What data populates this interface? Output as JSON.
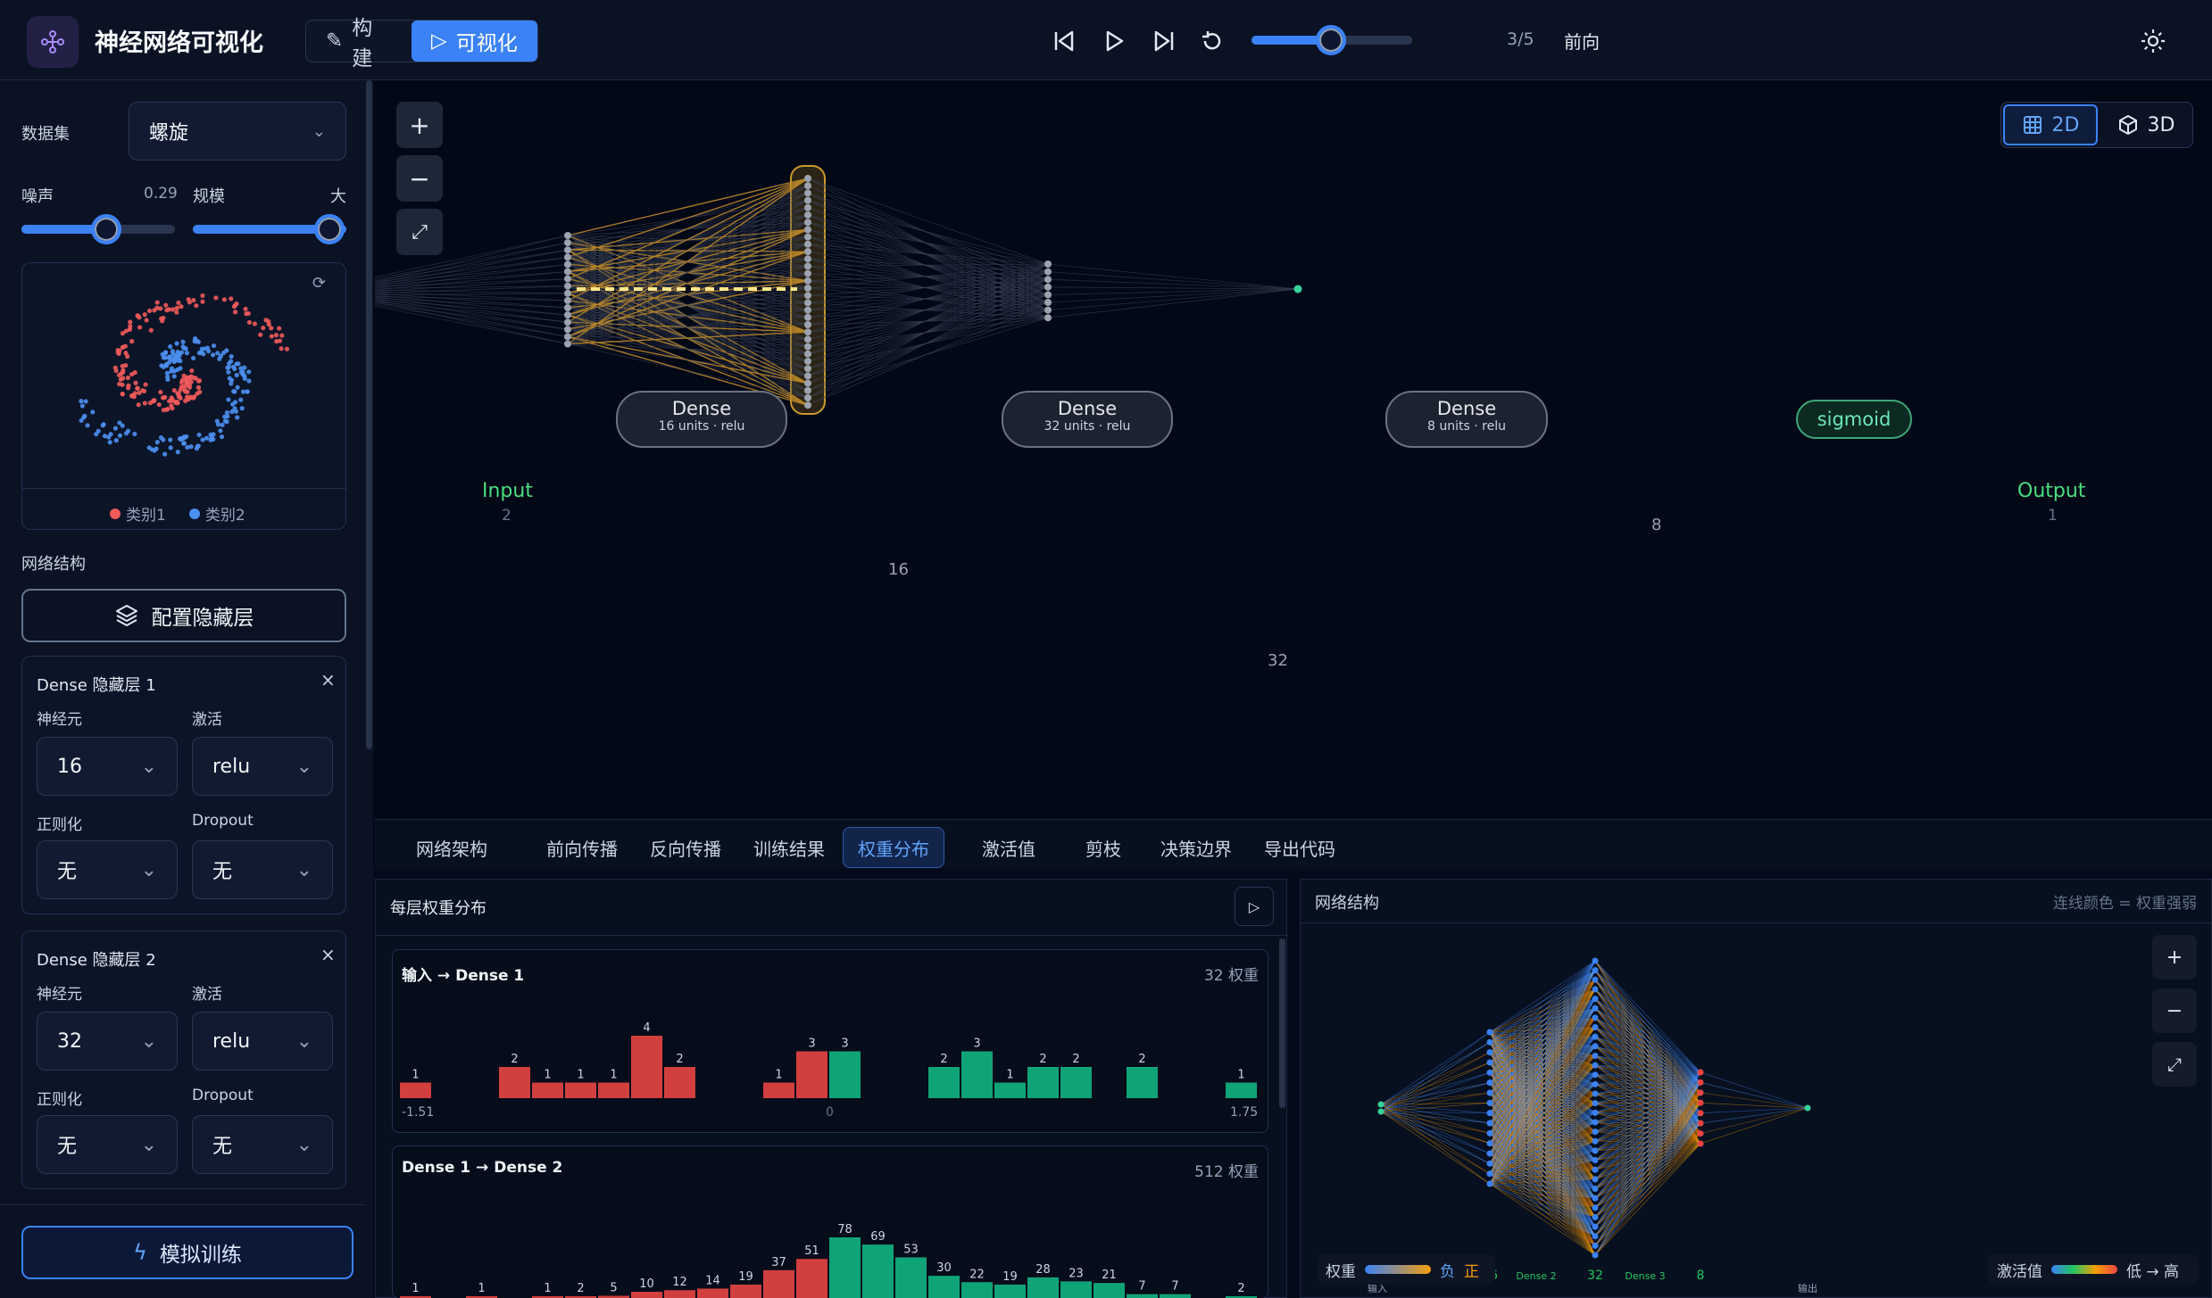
{
  "app": {
    "title": "神经网络可视化"
  },
  "header": {
    "modes": [
      {
        "label": "构建"
      },
      {
        "label": "可视化"
      }
    ],
    "step_text": "3/5",
    "direction": "前向",
    "progress": 0.5
  },
  "sidebar": {
    "dataset_label": "数据集",
    "dataset_value": "螺旋",
    "noise_label": "噪声",
    "noise_value": "0.29",
    "noise_level": 0.29,
    "scale_label": "规模",
    "scale_value": "大",
    "legend": [
      {
        "label": "类别1",
        "color": "#f05a5a"
      },
      {
        "label": "类别2",
        "color": "#4b8ff0"
      }
    ],
    "network_label": "网络结构",
    "config_button": "配置隐藏层",
    "layers": [
      {
        "title": "Dense 隐藏层 1",
        "neurons_label": "神经元",
        "neurons": "16",
        "activation_label": "激活",
        "activation": "relu",
        "reg_label": "正则化",
        "reg": "无",
        "dropout_label": "Dropout",
        "dropout": "无"
      },
      {
        "title": "Dense 隐藏层 2",
        "neurons_label": "神经元",
        "neurons": "32",
        "activation_label": "激活",
        "activation": "relu",
        "reg_label": "正则化",
        "reg": "无",
        "dropout_label": "Dropout",
        "dropout": "无"
      }
    ],
    "train_button": "模拟训练"
  },
  "canvas": {
    "view_2d": "2D",
    "view_3d": "3D",
    "input": {
      "name": "Input",
      "count": "2"
    },
    "output": {
      "name": "Output",
      "count": "1"
    },
    "pills": [
      {
        "title": "Dense",
        "sub": "16 units · relu"
      },
      {
        "title": "Dense",
        "sub": "32 units · relu"
      },
      {
        "title": "Dense",
        "sub": "8 units · relu"
      }
    ],
    "counts": [
      "16",
      "32",
      "8"
    ],
    "sigmoid": "sigmoid"
  },
  "tabs": [
    "网络架构",
    "前向传播",
    "反向传播",
    "训练结果",
    "权重分布",
    "激活值",
    "剪枝",
    "决策边界",
    "导出代码"
  ],
  "active_tab": 4,
  "weights_panel": {
    "title": "每层权重分布",
    "hist1": {
      "title": "输入 → Dense 1",
      "count": "32 权重",
      "min": "-1.51",
      "zero": "0",
      "max": "1.75",
      "bars": [
        1,
        0,
        0,
        2,
        1,
        1,
        1,
        4,
        2,
        0,
        0,
        1,
        3,
        3,
        0,
        0,
        2,
        3,
        1,
        2,
        2,
        0,
        2,
        0,
        0,
        1
      ],
      "labels": [
        "1",
        "",
        "",
        "2",
        "1",
        "1",
        "1",
        "4",
        "2",
        "",
        "",
        "1",
        "3",
        "3",
        "",
        "",
        "2",
        "3",
        "1",
        "2",
        "2",
        "",
        "2",
        "",
        "",
        "1"
      ]
    },
    "hist2": {
      "title": "Dense 1 → Dense 2",
      "count": "512 权重",
      "bars": [
        1,
        0,
        1,
        0,
        1,
        2,
        5,
        10,
        12,
        14,
        19,
        37,
        51,
        78,
        69,
        53,
        30,
        22,
        19,
        28,
        23,
        21,
        7,
        7,
        0,
        2
      ],
      "labels": [
        "1",
        "",
        "1",
        "",
        "1",
        "2",
        "5",
        "10",
        "12",
        "14",
        "19",
        "37",
        "51",
        "78",
        "69",
        "53",
        "30",
        "22",
        "19",
        "28",
        "23",
        "21",
        "7",
        "7",
        "",
        "2"
      ]
    }
  },
  "network_panel": {
    "title": "网络结构",
    "hint": "连线颜色 = 权重强弱",
    "legend_weight": "权重",
    "neg": "负",
    "pos": "正",
    "legend_act": "激活值",
    "act_range": "低 → 高",
    "bottom_labels": [
      "输入",
      "Dense 1",
      "16",
      "Dense 2",
      "32",
      "Dense 3",
      "8",
      "输出"
    ]
  }
}
